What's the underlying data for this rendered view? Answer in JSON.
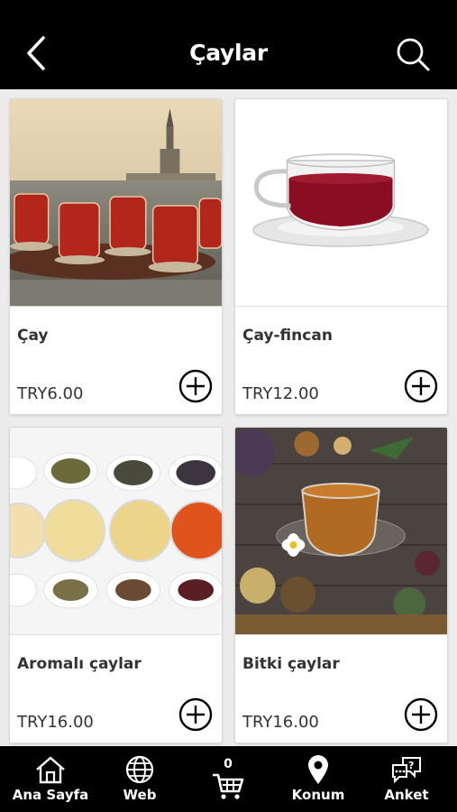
{
  "header": {
    "title": "Çaylar",
    "back_icon": "chevron-left-icon",
    "search_icon": "search-icon"
  },
  "products": [
    {
      "name": "Çay",
      "price": "TRY6.00",
      "image": "tea-glasses-bosphorus-photo"
    },
    {
      "name": "Çay-fincan",
      "price": "TRY12.00",
      "image": "tea-cup-saucer-photo"
    },
    {
      "name": "Aromalı çaylar",
      "price": "TRY16.00",
      "image": "flavored-teas-bowls-photo"
    },
    {
      "name": "Bitki çaylar",
      "price": "TRY16.00",
      "image": "herbal-tea-table-photo"
    }
  ],
  "bottom_nav": {
    "home": "Ana Sayfa",
    "web": "Web",
    "cart_count": "0",
    "location": "Konum",
    "survey": "Anket"
  },
  "colors": {
    "bar": "#000000",
    "background": "#ececec",
    "card": "#ffffff",
    "text": "#333333"
  }
}
